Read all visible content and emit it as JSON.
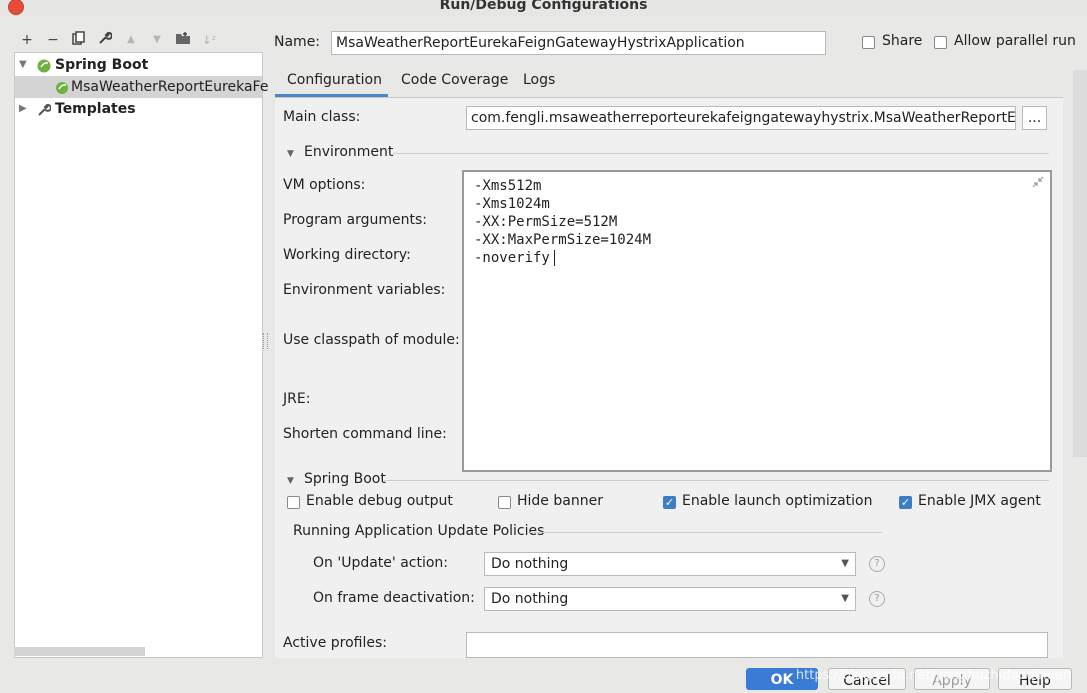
{
  "window": {
    "title": "Run/Debug Configurations"
  },
  "toolbar": {
    "add": "+",
    "remove": "−",
    "copy": "⧉",
    "edit": "🔧",
    "up": "▲",
    "down": "▼",
    "folder": "📁",
    "sort": "↓ᵃ"
  },
  "tree": {
    "spring_boot": "Spring Boot",
    "app_item": "MsaWeatherReportEurekaFe",
    "templates": "Templates"
  },
  "name_row": {
    "label": "Name:",
    "value": "MsaWeatherReportEurekaFeignGatewayHystrixApplication",
    "share": "Share",
    "allow_parallel": "Allow parallel run"
  },
  "tabs": [
    "Configuration",
    "Code Coverage",
    "Logs"
  ],
  "config": {
    "main_class_label": "Main class:",
    "main_class_value": "com.fengli.msaweatherreporteurekafeigngatewayhystrix.MsaWeatherReportE",
    "browse": "...",
    "environment_section": "Environment",
    "vm_options_label": "VM options:",
    "program_args_label": "Program arguments:",
    "working_dir_label": "Working directory:",
    "env_vars_label": "Environment variables:",
    "classpath_label": "Use classpath of module:",
    "jre_label": "JRE:",
    "shorten_label": "Shorten command line:",
    "vm_lines": [
      "-Xms512m",
      "-Xms1024m",
      "-XX:PermSize=512M",
      "-XX:MaxPermSize=1024M",
      "-noverify"
    ],
    "spring_boot_section": "Spring Boot",
    "enable_debug_output": "Enable debug output",
    "hide_banner": "Hide banner",
    "enable_launch_opt": "Enable launch optimization",
    "enable_jmx": "Enable JMX agent",
    "policies_title": "Running Application Update Policies",
    "on_update_label": "On 'Update' action:",
    "on_update_value": "Do nothing",
    "on_frame_label": "On frame deactivation:",
    "on_frame_value": "Do nothing",
    "active_profiles_label": "Active profiles:"
  },
  "buttons": {
    "ok": "OK",
    "cancel": "Cancel",
    "apply": "Apply",
    "help": "Help"
  },
  "watermark": "https://blog.csdn.net/yongbuzhidaoqihuan",
  "colors": {
    "accent": "#4a86c8",
    "ok_button": "#3a7bd5",
    "close": "#e84b3a"
  }
}
